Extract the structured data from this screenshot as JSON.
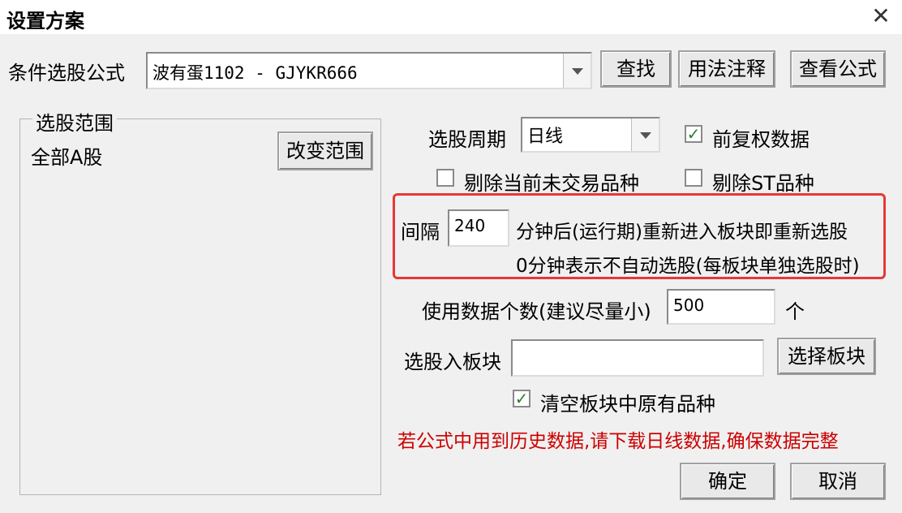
{
  "window": {
    "title": "设置方案",
    "close_symbol": "✕"
  },
  "formula": {
    "label": "条件选股公式",
    "value": "波有蛋1102  -  GJYKR666",
    "find_button": "查找",
    "usage_button": "用法注释",
    "view_button": "查看公式"
  },
  "range": {
    "group_title": "选股范围",
    "value": "全部A股",
    "change_button": "改变范围"
  },
  "period": {
    "label": "选股周期",
    "value": "日线"
  },
  "options": {
    "forward_adjust": {
      "label": "前复权数据",
      "checked": true
    },
    "exclude_untraded": {
      "label": "剔除当前未交易品种",
      "checked": false
    },
    "exclude_st": {
      "label": "剔除ST品种",
      "checked": false
    }
  },
  "interval": {
    "label": "间隔",
    "value": "240",
    "suffix": "分钟后(运行期)重新进入板块即重新选股",
    "note": "0分钟表示不自动选股(每板块单独选股时)"
  },
  "data_count": {
    "label": "使用数据个数(建议尽量小)",
    "value": "500",
    "unit": "个"
  },
  "block": {
    "label": "选股入板块",
    "value": "",
    "select_button": "选择板块",
    "clear_option": {
      "label": "清空板块中原有品种",
      "checked": true
    }
  },
  "warning": "若公式中用到历史数据,请下载日线数据,确保数据完整",
  "buttons": {
    "ok": "确定",
    "cancel": "取消"
  },
  "colors": {
    "highlight_border": "#e53935",
    "warning_text": "#cc0000",
    "check_mark": "#2e7d32"
  }
}
